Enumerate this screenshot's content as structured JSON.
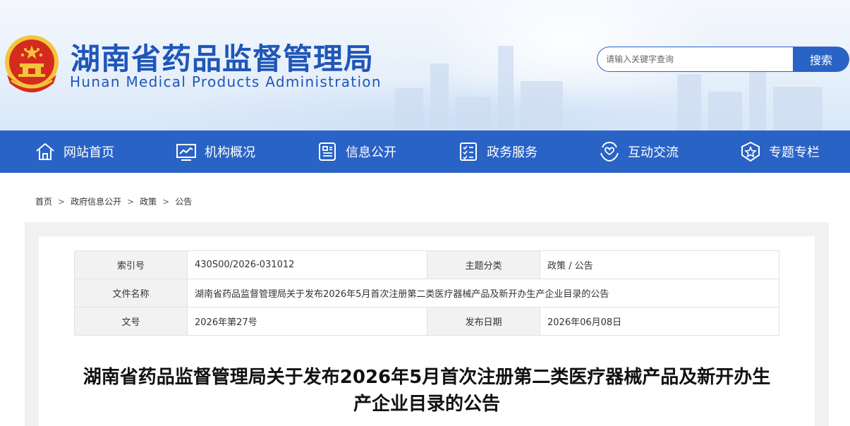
{
  "header": {
    "title": "湖南省药品监督管理局",
    "subtitle": "Hunan Medical Products Administration",
    "emblem_icon": "national-emblem-icon"
  },
  "search": {
    "placeholder": "请输入关键字查询",
    "button_label": "搜索"
  },
  "nav": {
    "items": [
      {
        "label": "网站首页",
        "icon": "home-icon"
      },
      {
        "label": "机构概况",
        "icon": "monitor-chart-icon"
      },
      {
        "label": "信息公开",
        "icon": "document-list-icon"
      },
      {
        "label": "政务服务",
        "icon": "checklist-icon"
      },
      {
        "label": "互动交流",
        "icon": "hand-heart-icon"
      },
      {
        "label": "专题专栏",
        "icon": "star-badge-icon"
      }
    ]
  },
  "breadcrumb": {
    "items": [
      "首页",
      "政府信息公开",
      "政策",
      "公告"
    ],
    "separator": ">"
  },
  "meta": {
    "index_label": "索引号",
    "index_value": "430S00/2026-031012",
    "topic_label": "主题分类",
    "topic_value": "政策 / 公告",
    "filename_label": "文件名称",
    "filename_value": "湖南省药品监督管理局关于发布2026年5月首次注册第二类医疗器械产品及新开办生产企业目录的公告",
    "docno_label": "文号",
    "docno_value": "2026年第27号",
    "date_label": "发布日期",
    "date_value": "2026年06月08日"
  },
  "article": {
    "title_line1": "湖南省药品监督管理局关于发布2026年5月首次注册第二类医疗器械产品及新开办生",
    "title_line2": "产企业目录的公告"
  },
  "colors": {
    "brand_blue": "#2a63c6",
    "title_blue": "#1f56b8",
    "emblem_red": "#d52a1e",
    "emblem_gold": "#f3c53a"
  }
}
